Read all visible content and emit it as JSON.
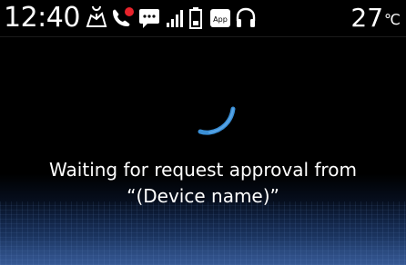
{
  "status_bar": {
    "time": "12:40",
    "temperature": "27",
    "temperature_unit": "℃",
    "icons": [
      "navigation-icon",
      "missed-call-icon",
      "message-icon",
      "signal-icon",
      "battery-icon",
      "app-icon",
      "headset-icon"
    ],
    "app_badge_label": "App"
  },
  "dialog": {
    "message_line_1": "Waiting for request approval from",
    "message_line_2": "“(Device name)”"
  },
  "colors": {
    "background": "#000000",
    "spinner": "#3a8fd6",
    "missed_call_badge": "#e8232b",
    "text": "#ffffff",
    "floor_glow": "#37609a"
  }
}
